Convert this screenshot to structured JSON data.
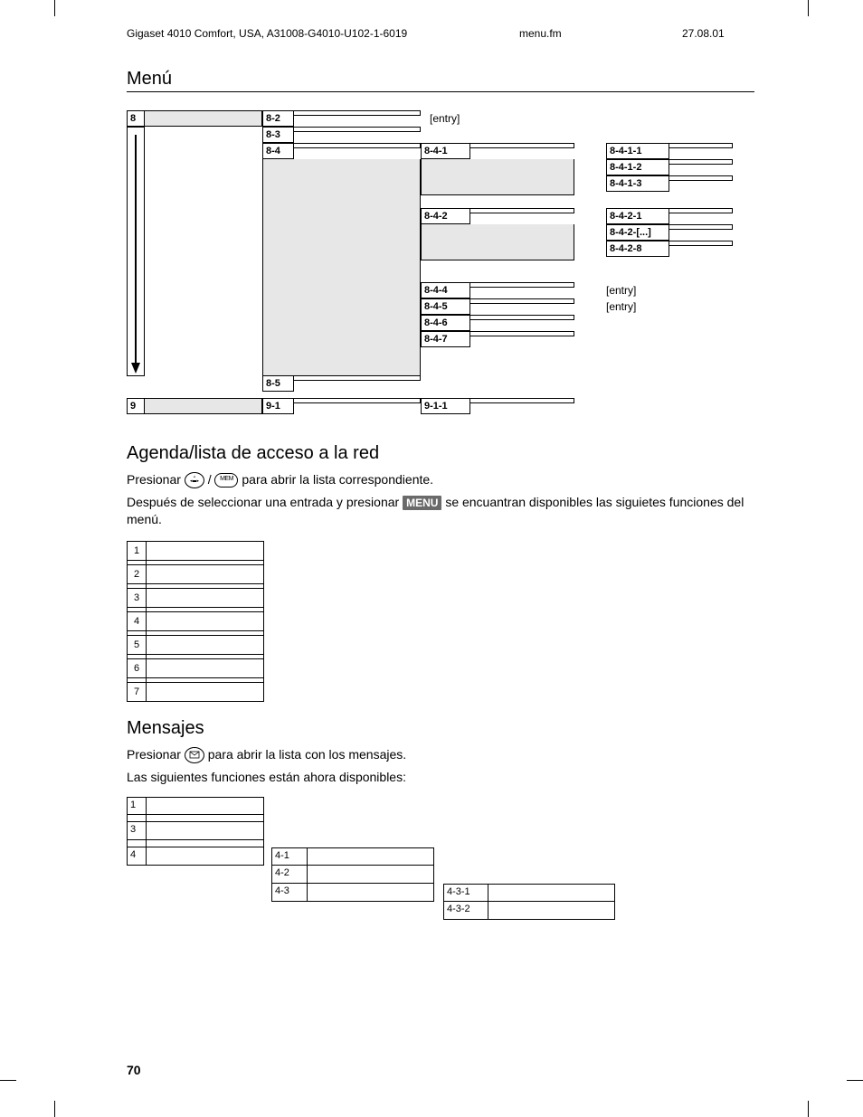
{
  "header": {
    "left": "Gigaset 4010 Comfort, USA, A31008-G4010-U102-1-6019",
    "mid": "menu.fm",
    "right": "27.08.01"
  },
  "title": "Menú",
  "tree": {
    "c8": "8",
    "c82": "8-2",
    "c83": "8-3",
    "c84": "8-4",
    "entry82": "[entry]",
    "c841": "8-4-1",
    "c8411": "8-4-1-1",
    "c8412": "8-4-1-2",
    "c8413": "8-4-1-3",
    "c842": "8-4-2",
    "c8421": "8-4-2-1",
    "c842d": "8-4-2-[...]",
    "c8428": "8-4-2-8",
    "c844": "8-4-4",
    "c845": "8-4-5",
    "c846": "8-4-6",
    "c847": "8-4-7",
    "entry844": "[entry]",
    "entry845": "[entry]",
    "c85": "8-5",
    "c9": "9",
    "c91": "9-1",
    "c911": "9-1-1"
  },
  "agenda": {
    "heading": "Agenda/lista de acceso a la red",
    "p1a": "Presionar ",
    "p1b": " / ",
    "p1c": " para abrir la lista correspondiente.",
    "p2a": "Después de seleccionar una entrada y presionar ",
    "menu": "MENU",
    "p2b": " se encuantran disponibles las siguietes funciones del menú.",
    "nums": [
      "1",
      "2",
      "3",
      "4",
      "5",
      "6",
      "7"
    ]
  },
  "mensajes": {
    "heading": "Mensajes",
    "p1a": "Presionar ",
    "p1b": " para abrir la lista con los mensajes.",
    "p2": "Las siguientes funciones están ahora disponibles:",
    "n1": "1",
    "n3": "3",
    "n4": "4",
    "c41": "4-1",
    "c42": "4-2",
    "c43": "4-3",
    "c431": "4-3-1",
    "c432": "4-3-2"
  },
  "pagenum": "70",
  "mem": "MEM"
}
